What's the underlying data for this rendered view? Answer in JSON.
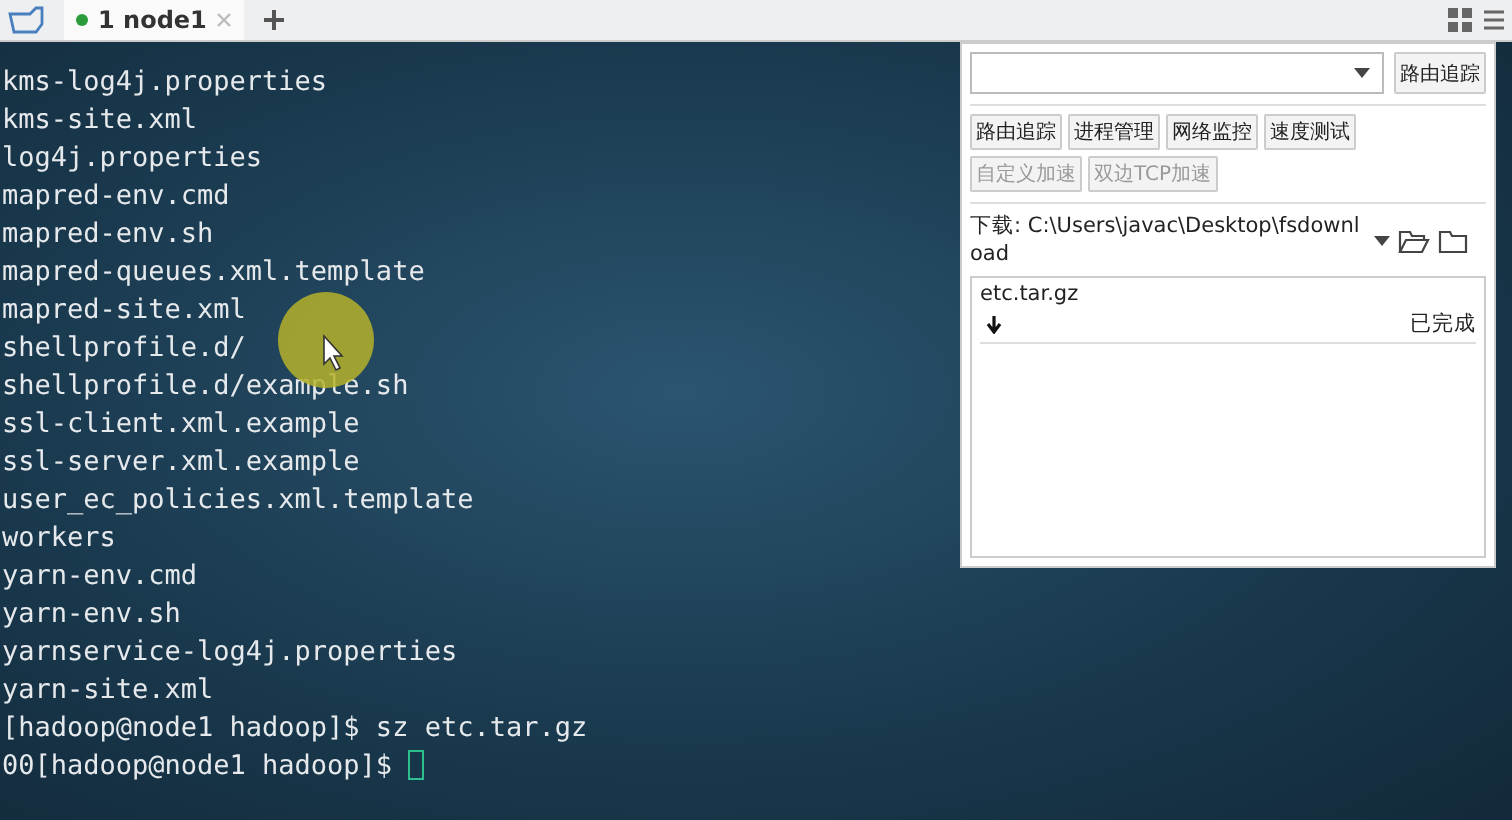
{
  "tabs": [
    {
      "label": "1 node1",
      "selected": true,
      "connected": true
    }
  ],
  "terminal": {
    "lines": [
      "kms-log4j.properties",
      "kms-site.xml",
      "log4j.properties",
      "mapred-env.cmd",
      "mapred-env.sh",
      "mapred-queues.xml.template",
      "mapred-site.xml",
      "shellprofile.d/",
      "shellprofile.d/example.sh",
      "ssl-client.xml.example",
      "ssl-server.xml.example",
      "user_ec_policies.xml.template",
      "workers",
      "yarn-env.cmd",
      "yarn-env.sh",
      "yarnservice-log4j.properties",
      "yarn-site.xml",
      "[hadoop@node1 hadoop]$ sz etc.tar.gz",
      "00[hadoop@node1 hadoop]$ "
    ]
  },
  "panel": {
    "trace_button": "路由追踪",
    "tools": [
      {
        "label": "路由追踪",
        "disabled": false
      },
      {
        "label": "进程管理",
        "disabled": false
      },
      {
        "label": "网络监控",
        "disabled": false
      },
      {
        "label": "速度测试",
        "disabled": false
      },
      {
        "label": "自定义加速",
        "disabled": true
      },
      {
        "label": "双边TCP加速",
        "disabled": true
      }
    ],
    "download_path": "下载: C:\\Users\\javac\\Desktop\\fsdownload",
    "transfers": [
      {
        "name": "etc.tar.gz",
        "status": "已完成"
      }
    ]
  }
}
